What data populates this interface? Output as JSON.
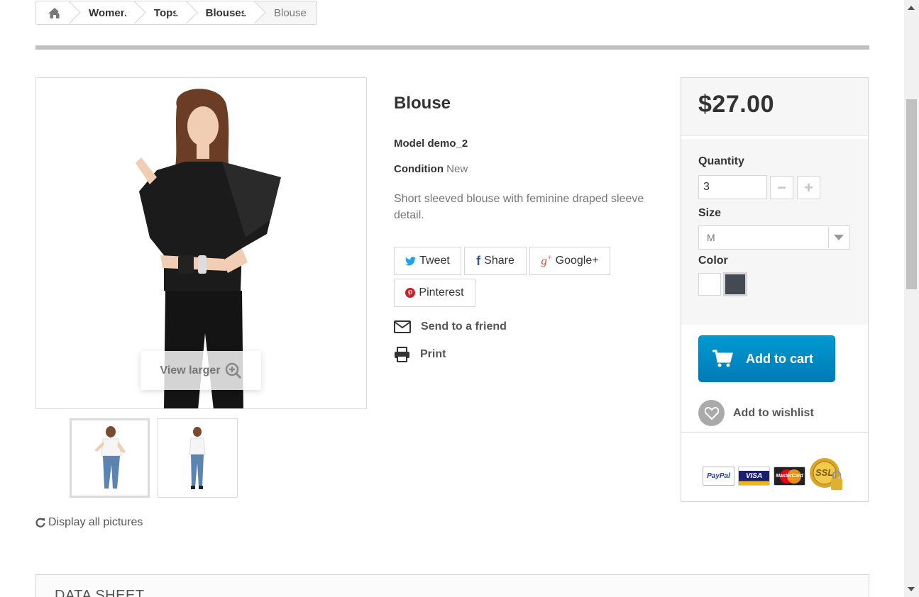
{
  "breadcrumb": {
    "home_icon": "home-icon",
    "items": [
      "Women",
      "Tops",
      "Blouses"
    ],
    "current": "Blouse"
  },
  "product": {
    "name": "Blouse",
    "model": "Model demo_2",
    "condition_label": "Condition",
    "condition_value": "New",
    "description": "Short sleeved blouse with feminine draped sleeve detail."
  },
  "image": {
    "view_larger": "View larger",
    "display_all": "Display all pictures"
  },
  "social": {
    "tweet": "Tweet",
    "share": "Share",
    "googleplus": "Google+",
    "pinterest": "Pinterest",
    "twitter_color": "#1da1f2",
    "facebook_color": "#3b5998",
    "google_color": "#dd4b39",
    "pinterest_color": "#cb2027"
  },
  "actions": {
    "send_friend": "Send to a friend",
    "print": "Print"
  },
  "buy": {
    "price": "$27.00",
    "quantity_label": "Quantity",
    "quantity_value": "3",
    "size_label": "Size",
    "size_value": "M",
    "color_label": "Color",
    "colors": [
      "#ffffff",
      "#434a54"
    ],
    "add_to_cart": "Add to cart",
    "add_to_wishlist": "Add to wishlist",
    "accent_color": "#0089c4"
  },
  "payments": {
    "paypal": "PayPal",
    "visa": "VISA",
    "mastercard": "MasterCard",
    "ssl": "SSL"
  },
  "datasheet": {
    "title": "DATA SHEET"
  }
}
